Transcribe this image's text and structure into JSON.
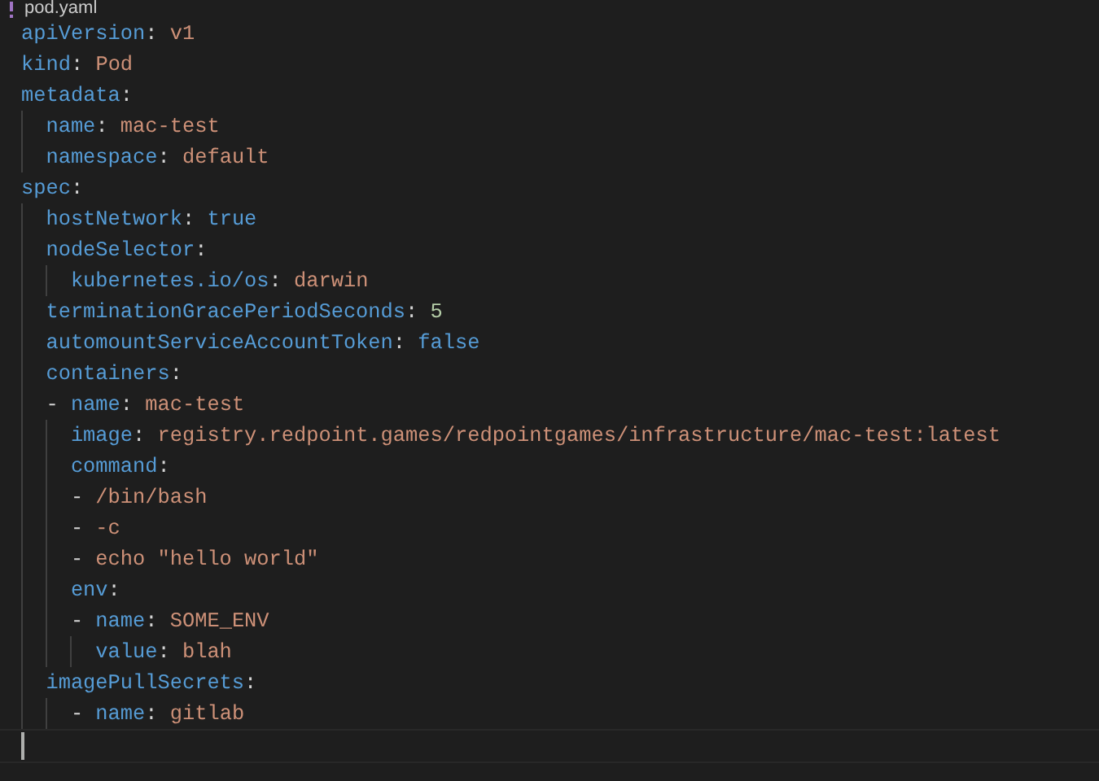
{
  "breadcrumb": {
    "file": "pod.yaml"
  },
  "lines": [
    {
      "tokens": [
        {
          "kind": "key",
          "text": "apiVersion"
        },
        {
          "kind": "punct",
          "text": ": "
        },
        {
          "kind": "string",
          "text": "v1"
        }
      ]
    },
    {
      "tokens": [
        {
          "kind": "key",
          "text": "kind"
        },
        {
          "kind": "punct",
          "text": ": "
        },
        {
          "kind": "string",
          "text": "Pod"
        }
      ]
    },
    {
      "tokens": [
        {
          "kind": "key",
          "text": "metadata"
        },
        {
          "kind": "punct",
          "text": ":"
        }
      ],
      "children": [
        {
          "tokens": [
            {
              "kind": "key",
              "text": "name"
            },
            {
              "kind": "punct",
              "text": ": "
            },
            {
              "kind": "string",
              "text": "mac-test"
            }
          ]
        },
        {
          "tokens": [
            {
              "kind": "key",
              "text": "namespace"
            },
            {
              "kind": "punct",
              "text": ": "
            },
            {
              "kind": "string",
              "text": "default"
            }
          ]
        }
      ]
    },
    {
      "tokens": [
        {
          "kind": "key",
          "text": "spec"
        },
        {
          "kind": "punct",
          "text": ":"
        }
      ],
      "children": [
        {
          "tokens": [
            {
              "kind": "key",
              "text": "hostNetwork"
            },
            {
              "kind": "punct",
              "text": ": "
            },
            {
              "kind": "keyword",
              "text": "true"
            }
          ]
        },
        {
          "tokens": [
            {
              "kind": "key",
              "text": "nodeSelector"
            },
            {
              "kind": "punct",
              "text": ":"
            }
          ],
          "children": [
            {
              "tokens": [
                {
                  "kind": "key",
                  "text": "kubernetes.io/os"
                },
                {
                  "kind": "punct",
                  "text": ": "
                },
                {
                  "kind": "string",
                  "text": "darwin"
                }
              ]
            }
          ]
        },
        {
          "tokens": [
            {
              "kind": "key",
              "text": "terminationGracePeriodSeconds"
            },
            {
              "kind": "punct",
              "text": ": "
            },
            {
              "kind": "number",
              "text": "5"
            }
          ]
        },
        {
          "tokens": [
            {
              "kind": "key",
              "text": "automountServiceAccountToken"
            },
            {
              "kind": "punct",
              "text": ": "
            },
            {
              "kind": "keyword",
              "text": "false"
            }
          ]
        },
        {
          "tokens": [
            {
              "kind": "key",
              "text": "containers"
            },
            {
              "kind": "punct",
              "text": ":"
            }
          ],
          "children": [
            {
              "tokens": [
                {
                  "kind": "dash",
                  "text": "- "
                },
                {
                  "kind": "key",
                  "text": "name"
                },
                {
                  "kind": "punct",
                  "text": ": "
                },
                {
                  "kind": "string",
                  "text": "mac-test"
                }
              ],
              "children": [
                {
                  "tokens": [
                    {
                      "kind": "key",
                      "text": "image"
                    },
                    {
                      "kind": "punct",
                      "text": ": "
                    },
                    {
                      "kind": "string",
                      "text": "registry.redpoint.games/redpointgames/infrastructure/mac-test:latest"
                    }
                  ]
                },
                {
                  "tokens": [
                    {
                      "kind": "key",
                      "text": "command"
                    },
                    {
                      "kind": "punct",
                      "text": ":"
                    }
                  ],
                  "children": [
                    {
                      "tokens": [
                        {
                          "kind": "dash",
                          "text": "- "
                        },
                        {
                          "kind": "string",
                          "text": "/bin/bash"
                        }
                      ]
                    },
                    {
                      "tokens": [
                        {
                          "kind": "dash",
                          "text": "- "
                        },
                        {
                          "kind": "string",
                          "text": "-c"
                        }
                      ]
                    },
                    {
                      "tokens": [
                        {
                          "kind": "dash",
                          "text": "- "
                        },
                        {
                          "kind": "string",
                          "text": "echo \"hello world\""
                        }
                      ]
                    }
                  ]
                },
                {
                  "tokens": [
                    {
                      "kind": "key",
                      "text": "env"
                    },
                    {
                      "kind": "punct",
                      "text": ":"
                    }
                  ],
                  "children": [
                    {
                      "tokens": [
                        {
                          "kind": "dash",
                          "text": "- "
                        },
                        {
                          "kind": "key",
                          "text": "name"
                        },
                        {
                          "kind": "punct",
                          "text": ": "
                        },
                        {
                          "kind": "string",
                          "text": "SOME_ENV"
                        }
                      ],
                      "children": [
                        {
                          "tokens": [
                            {
                              "kind": "key",
                              "text": "value"
                            },
                            {
                              "kind": "punct",
                              "text": ": "
                            },
                            {
                              "kind": "string",
                              "text": "blah"
                            }
                          ]
                        }
                      ]
                    }
                  ]
                }
              ]
            }
          ]
        },
        {
          "tokens": [
            {
              "kind": "key",
              "text": "imagePullSecrets"
            },
            {
              "kind": "punct",
              "text": ":"
            }
          ],
          "list_indented": true,
          "children": [
            {
              "tokens": [
                {
                  "kind": "dash",
                  "text": "- "
                },
                {
                  "kind": "key",
                  "text": "name"
                },
                {
                  "kind": "punct",
                  "text": ": "
                },
                {
                  "kind": "string",
                  "text": "gitlab"
                }
              ]
            }
          ]
        }
      ]
    }
  ]
}
